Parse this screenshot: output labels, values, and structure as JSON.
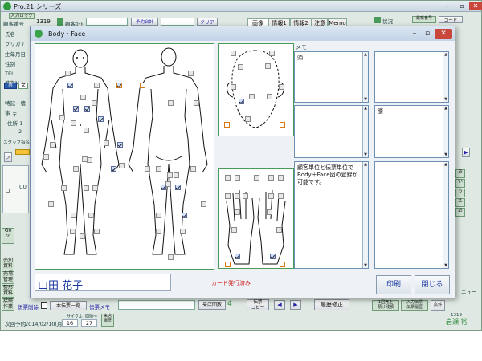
{
  "app": {
    "title": "Pro.21  シリーズ",
    "tag": "入力ロック",
    "row_labels": [
      "顧客番号",
      "氏名",
      "フリガナ",
      "生年月日",
      "性別",
      "TEL",
      "携帯№",
      "",
      "特記・嗜事"
    ],
    "customer_no_label": "顧客番号",
    "customer_no": "1319",
    "customer_code_label": "顧客ｺｰﾄﾞ",
    "hours_btn": "予約台計",
    "clear_btn": "クリア",
    "tabs": [
      "画像",
      "情報1",
      "情報2",
      "注意",
      "Memo"
    ],
    "right_top": {
      "status": "状況",
      "btn1": "最新番号",
      "btn2": "コード"
    },
    "gender_chips": [
      "男",
      "女"
    ],
    "side_items": [
      "〒",
      "住所-1",
      "2",
      "スタッフ指名"
    ],
    "left_btns": [
      "Go\nto",
      "売別\n資料",
      "売場\n管理",
      "整形\n資料",
      "接続\n作業"
    ],
    "letter_buttons": [
      "あ",
      "い",
      "う",
      "え",
      "お"
    ],
    "menu_label": "ニュー",
    "bottom": {
      "delete_label": "伝票削除",
      "slip_list": "本伝票一覧",
      "slip_memo": "伝票メモ",
      "visits_label": "来店回数",
      "visits": "4",
      "slip_copy": "伝票\nコピー",
      "history_fix": "履歴修正",
      "next_label": "次回予約",
      "next_date": "2014/02/10(月)",
      "cycle_label": "サイクル",
      "interval_label": "間隔～",
      "cycle": "16",
      "interval": "27",
      "visit_label": "来店\n履歴",
      "chart_btn": "1回売上\n預け残額",
      "receipt_btn": "入力伝票\n伝票履歴",
      "accounting": "会計",
      "customer_no2": "1319",
      "staff": "岩瀬  裕"
    }
  },
  "dialog": {
    "title": "Body・Face",
    "customer_name": "山田  花子",
    "card_status": "カード発行済み",
    "memo_label": "メモ",
    "memo": [
      "頭",
      "",
      "腰",
      "",
      "",
      "顧客単位と伝票単位でBody＋Face図の登録が可能です。",
      ""
    ],
    "print_btn": "印刷",
    "close_btn": "閉じる",
    "checkboxes": [
      {
        "id": "b1",
        "on": false,
        "orange": false
      },
      {
        "id": "b2",
        "on": true,
        "orange": false
      },
      {
        "id": "b3",
        "on": false,
        "orange": false
      },
      {
        "id": "b4",
        "on": true,
        "orange": true
      },
      {
        "id": "b5",
        "on": false,
        "orange": true
      },
      {
        "id": "b6",
        "on": false,
        "orange": false
      },
      {
        "id": "b7",
        "on": false,
        "orange": false
      },
      {
        "id": "b8",
        "on": true,
        "orange": false
      },
      {
        "id": "b9",
        "on": true,
        "orange": false
      },
      {
        "id": "b10",
        "on": false,
        "orange": false
      },
      {
        "id": "b11",
        "on": false,
        "orange": false
      },
      {
        "id": "b12",
        "on": true,
        "orange": false
      },
      {
        "id": "b13",
        "on": false,
        "orange": false
      },
      {
        "id": "b14",
        "on": false,
        "orange": false
      },
      {
        "id": "b15",
        "on": false,
        "orange": false
      },
      {
        "id": "b16",
        "on": false,
        "orange": false
      },
      {
        "id": "b17",
        "on": false,
        "orange": false
      },
      {
        "id": "b18",
        "on": true,
        "orange": false
      },
      {
        "id": "b19",
        "on": false,
        "orange": false
      },
      {
        "id": "b20",
        "on": false,
        "orange": false
      },
      {
        "id": "b21",
        "on": false,
        "orange": false
      },
      {
        "id": "b22",
        "on": true,
        "orange": false
      },
      {
        "id": "b23",
        "on": false,
        "orange": false
      },
      {
        "id": "b24",
        "on": false,
        "orange": false
      },
      {
        "id": "b25",
        "on": false,
        "orange": false
      },
      {
        "id": "b26",
        "on": false,
        "orange": false
      },
      {
        "id": "b27",
        "on": false,
        "orange": false
      },
      {
        "id": "b28",
        "on": false,
        "orange": false
      },
      {
        "id": "b29",
        "on": false,
        "orange": false
      },
      {
        "id": "b30",
        "on": false,
        "orange": false
      },
      {
        "id": "b31",
        "on": false,
        "orange": false
      },
      {
        "id": "b32",
        "on": false,
        "orange": false
      },
      {
        "id": "b33",
        "on": false,
        "orange": false
      },
      {
        "id": "b34",
        "on": false,
        "orange": false
      },
      {
        "id": "b35",
        "on": true,
        "orange": false
      },
      {
        "id": "b36",
        "on": true,
        "orange": false
      },
      {
        "id": "b37",
        "on": false,
        "orange": false
      },
      {
        "id": "b38",
        "on": false,
        "orange": false
      },
      {
        "id": "b39",
        "on": false,
        "orange": false
      },
      {
        "id": "b40",
        "on": false,
        "orange": false
      },
      {
        "id": "b41",
        "on": false,
        "orange": false
      },
      {
        "id": "b42",
        "on": true,
        "orange": false
      },
      {
        "id": "b43",
        "on": false,
        "orange": false
      },
      {
        "id": "b44",
        "on": false,
        "orange": false
      },
      {
        "id": "b45",
        "on": false,
        "orange": false
      },
      {
        "id": "b46",
        "on": false,
        "orange": false
      },
      {
        "id": "b47",
        "on": false,
        "orange": false
      },
      {
        "id": "b48",
        "on": false,
        "orange": false
      },
      {
        "id": "f1",
        "on": false,
        "orange": false
      },
      {
        "id": "f2",
        "on": false,
        "orange": false
      },
      {
        "id": "f3",
        "on": false,
        "orange": false
      },
      {
        "id": "f4",
        "on": false,
        "orange": false
      },
      {
        "id": "f5",
        "on": true,
        "orange": false
      },
      {
        "id": "f6",
        "on": false,
        "orange": false
      },
      {
        "id": "f7",
        "on": false,
        "orange": false
      },
      {
        "id": "f8",
        "on": false,
        "orange": false
      },
      {
        "id": "f9",
        "on": false,
        "orange": false
      },
      {
        "id": "f10",
        "on": false,
        "orange": false
      },
      {
        "id": "f11",
        "on": false,
        "orange": true
      },
      {
        "id": "f12",
        "on": false,
        "orange": true
      },
      {
        "id": "h1",
        "on": false,
        "orange": false
      },
      {
        "id": "h2",
        "on": false,
        "orange": false
      },
      {
        "id": "h3",
        "on": false,
        "orange": false
      },
      {
        "id": "h4",
        "on": false,
        "orange": false
      },
      {
        "id": "h5",
        "on": false,
        "orange": false
      },
      {
        "id": "h6",
        "on": false,
        "orange": false
      },
      {
        "id": "h7",
        "on": false,
        "orange": false
      },
      {
        "id": "h8",
        "on": false,
        "orange": false
      },
      {
        "id": "h9",
        "on": false,
        "orange": false
      },
      {
        "id": "h10",
        "on": false,
        "orange": false
      },
      {
        "id": "h11",
        "on": false,
        "orange": false
      },
      {
        "id": "h12",
        "on": false,
        "orange": false
      },
      {
        "id": "h13",
        "on": false,
        "orange": false
      },
      {
        "id": "h14",
        "on": false,
        "orange": false
      },
      {
        "id": "h15",
        "on": true,
        "orange": false
      },
      {
        "id": "h16",
        "on": true,
        "orange": false
      },
      {
        "id": "h17",
        "on": false,
        "orange": true
      },
      {
        "id": "h18",
        "on": false,
        "orange": true
      }
    ]
  },
  "colors": {
    "panel_border": "#4a9a5a",
    "dialog_title": "#c3d3e6",
    "name_text": "#1a3aa0",
    "card_status": "#d02020",
    "check_orange": "#d87a12"
  }
}
